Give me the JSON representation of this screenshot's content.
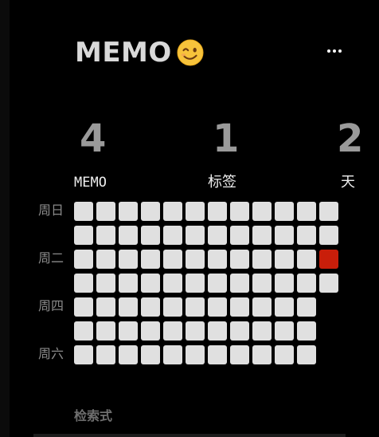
{
  "header": {
    "title": "MEMO",
    "emoji_icon": "winking-face-emoji",
    "more_icon": "more-horizontal-icon"
  },
  "stats": [
    {
      "value": "4",
      "label": "MEMO"
    },
    {
      "value": "1",
      "label": "标签"
    },
    {
      "value": "2",
      "label": "天"
    }
  ],
  "heatmap": {
    "day_labels": [
      "周日",
      "",
      "周二",
      "",
      "周四",
      "",
      "周六"
    ],
    "columns": 12,
    "rows": 7,
    "last_column_filled_rows": 4,
    "active_cell": {
      "row": 2,
      "col": 11
    },
    "empty_color": "#e0e0e0",
    "active_color": "#c91e0a"
  },
  "sections": {
    "search_title": "检索式"
  }
}
